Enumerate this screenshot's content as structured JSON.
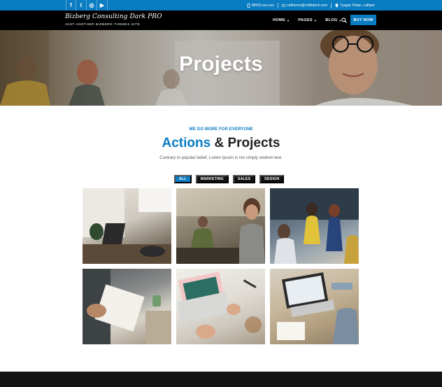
{
  "topbar": {
    "social": [
      {
        "icon": "facebook-icon",
        "glyph": "f"
      },
      {
        "icon": "twitter-icon",
        "glyph": "t"
      },
      {
        "icon": "instagram-icon",
        "glyph": "◎"
      },
      {
        "icon": "youtube-icon",
        "glyph": "▶"
      }
    ],
    "phone": "98416-xxx-xxx",
    "email": "cnttheme@cnttfotech.com",
    "address": "Tyagal, Patan, Lalitpur"
  },
  "header": {
    "site_title": "Bizberg Consulting Dark PRO",
    "tagline": "JUST ANOTHER BIZBERG THEMES SITE",
    "nav": [
      {
        "label": "HOME",
        "has_dropdown": true
      },
      {
        "label": "PAGES",
        "has_dropdown": true
      },
      {
        "label": "BLOG",
        "has_dropdown": true
      }
    ],
    "buy_label": "BUY NOW"
  },
  "hero": {
    "title": "Projects"
  },
  "section": {
    "eyebrow": "WE DO MORE FOR EVERYONE",
    "headline_accent": "Actions",
    "headline_rest": "& Projects",
    "subline": "Contrary to popular belief, Lorem Ipsum is not simply random text."
  },
  "filters": [
    {
      "label": "ALL",
      "active": true
    },
    {
      "label": "MARKETING",
      "active": false
    },
    {
      "label": "SALES",
      "active": false
    },
    {
      "label": "DESIGN",
      "active": false
    }
  ],
  "colors": {
    "accent": "#0a7cc1",
    "dark": "#000000",
    "filter_bg": "#111111"
  }
}
